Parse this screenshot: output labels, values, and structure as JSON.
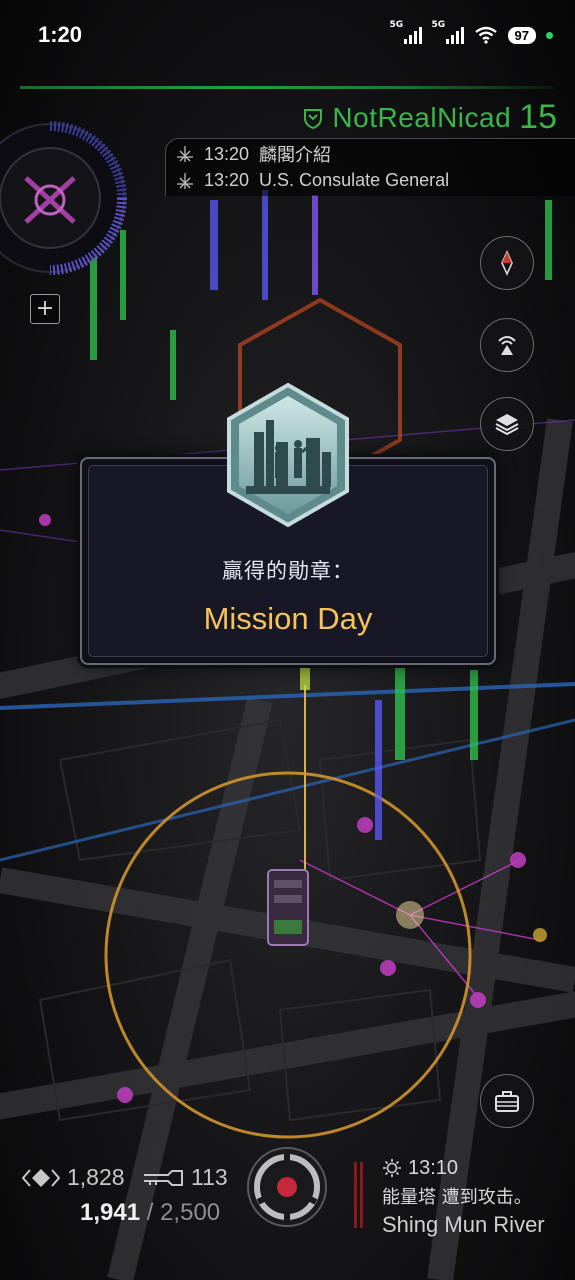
{
  "status_bar": {
    "time": "1:20",
    "network_1": "5G",
    "network_2": "5G",
    "battery": "97"
  },
  "agent": {
    "name": "NotRealNicad",
    "level": "15",
    "faction_color": "#39b54a"
  },
  "comm": {
    "items": [
      {
        "time": "13:20",
        "text": "麟閣介紹"
      },
      {
        "time": "13:20",
        "text": "U.S. Consulate General"
      }
    ]
  },
  "icons": {
    "scanner": "plus-square-icon",
    "compass": "compass-icon",
    "signal": "broadcast-icon",
    "layers": "layers-icon",
    "inventory": "briefcase-icon",
    "ops": "ops-scanner-icon"
  },
  "badge_modal": {
    "label": "贏得的勛章：",
    "title": "Mission Day",
    "title_color": "#f6c35b"
  },
  "bottom": {
    "resonators_count": "1,828",
    "keys_count": "113",
    "xm_current": "1,941",
    "xm_separator": "/",
    "xm_max": "2,500"
  },
  "feed": {
    "time": "13:10",
    "message": "能量塔 遭到攻击。",
    "location": "Shing Mun River"
  },
  "colors": {
    "accent_green": "#39b54a",
    "accent_gold": "#f6c35b",
    "alert_red": "#8a1a1a"
  }
}
